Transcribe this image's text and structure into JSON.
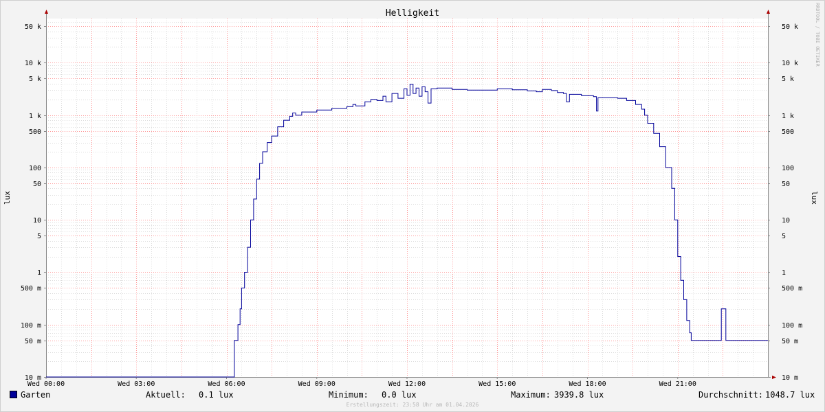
{
  "chart_data": {
    "type": "line",
    "title": "Helligkeit",
    "ylabel": "lux",
    "ylabel_right": "lux",
    "watermark": "RRDTOOL / TOBI OETIKER",
    "yscale": "log",
    "ylim": [
      0.01,
      70000
    ],
    "xlim_hours": [
      0,
      24
    ],
    "x_ticks": [
      {
        "h": 0,
        "label": "Wed 00:00"
      },
      {
        "h": 3,
        "label": "Wed 03:00"
      },
      {
        "h": 6,
        "label": "Wed 06:00"
      },
      {
        "h": 9,
        "label": "Wed 09:00"
      },
      {
        "h": 12,
        "label": "Wed 12:00"
      },
      {
        "h": 15,
        "label": "Wed 15:00"
      },
      {
        "h": 18,
        "label": "Wed 18:00"
      },
      {
        "h": 21,
        "label": "Wed 21:00"
      }
    ],
    "y_ticks": [
      {
        "v": 0.01,
        "label": "10 m"
      },
      {
        "v": 0.05,
        "label": "50 m"
      },
      {
        "v": 0.1,
        "label": "100 m"
      },
      {
        "v": 0.5,
        "label": "500 m"
      },
      {
        "v": 1,
        "label": "1"
      },
      {
        "v": 5,
        "label": "5"
      },
      {
        "v": 10,
        "label": "10"
      },
      {
        "v": 50,
        "label": "50"
      },
      {
        "v": 100,
        "label": "100"
      },
      {
        "v": 500,
        "label": "500"
      },
      {
        "v": 1000,
        "label": "1 k"
      },
      {
        "v": 5000,
        "label": "5 k"
      },
      {
        "v": 10000,
        "label": "10 k"
      },
      {
        "v": 50000,
        "label": "50 k"
      }
    ],
    "grid": true,
    "colors": {
      "series": "#000099",
      "major_grid": "#ff9999",
      "minor_grid": "#dddddd",
      "arrow": "#aa0000"
    },
    "series": [
      {
        "name": "Garten",
        "color": "#000099",
        "points": [
          [
            0,
            0.01
          ],
          [
            6.25,
            0.01
          ],
          [
            6.26,
            0.05
          ],
          [
            6.35,
            0.05
          ],
          [
            6.38,
            0.1
          ],
          [
            6.45,
            0.2
          ],
          [
            6.5,
            0.5
          ],
          [
            6.6,
            1
          ],
          [
            6.7,
            3
          ],
          [
            6.8,
            10
          ],
          [
            6.9,
            25
          ],
          [
            7.0,
            60
          ],
          [
            7.1,
            120
          ],
          [
            7.2,
            200
          ],
          [
            7.35,
            300
          ],
          [
            7.5,
            400
          ],
          [
            7.7,
            600
          ],
          [
            7.9,
            800
          ],
          [
            8.1,
            950
          ],
          [
            8.2,
            1100
          ],
          [
            8.3,
            1000
          ],
          [
            8.5,
            1150
          ],
          [
            9.0,
            1250
          ],
          [
            9.5,
            1350
          ],
          [
            10.0,
            1450
          ],
          [
            10.2,
            1600
          ],
          [
            10.3,
            1500
          ],
          [
            10.6,
            1800
          ],
          [
            10.8,
            2000
          ],
          [
            11.0,
            1900
          ],
          [
            11.2,
            2300
          ],
          [
            11.3,
            1800
          ],
          [
            11.5,
            2600
          ],
          [
            11.7,
            2100
          ],
          [
            11.9,
            3200
          ],
          [
            12.0,
            2400
          ],
          [
            12.1,
            3900
          ],
          [
            12.2,
            2600
          ],
          [
            12.3,
            3300
          ],
          [
            12.4,
            2300
          ],
          [
            12.5,
            3500
          ],
          [
            12.6,
            2800
          ],
          [
            12.7,
            1700
          ],
          [
            12.8,
            3200
          ],
          [
            13.0,
            3300
          ],
          [
            13.5,
            3100
          ],
          [
            14.0,
            3000
          ],
          [
            14.5,
            3000
          ],
          [
            15.0,
            3200
          ],
          [
            15.5,
            3050
          ],
          [
            16.0,
            2900
          ],
          [
            16.3,
            2800
          ],
          [
            16.5,
            3100
          ],
          [
            16.8,
            2950
          ],
          [
            17.0,
            2700
          ],
          [
            17.2,
            2600
          ],
          [
            17.3,
            1800
          ],
          [
            17.4,
            2500
          ],
          [
            17.8,
            2350
          ],
          [
            18.2,
            2250
          ],
          [
            18.3,
            1200
          ],
          [
            18.35,
            2150
          ],
          [
            19.0,
            2100
          ],
          [
            19.3,
            1900
          ],
          [
            19.6,
            1600
          ],
          [
            19.8,
            1300
          ],
          [
            19.9,
            1000
          ],
          [
            20.0,
            700
          ],
          [
            20.2,
            450
          ],
          [
            20.4,
            250
          ],
          [
            20.6,
            100
          ],
          [
            20.8,
            40
          ],
          [
            20.9,
            10
          ],
          [
            21.0,
            2
          ],
          [
            21.1,
            0.7
          ],
          [
            21.2,
            0.3
          ],
          [
            21.3,
            0.12
          ],
          [
            21.4,
            0.07
          ],
          [
            21.45,
            0.05
          ],
          [
            22.4,
            0.05
          ],
          [
            22.45,
            0.2
          ],
          [
            22.55,
            0.2
          ],
          [
            22.6,
            0.05
          ],
          [
            24,
            0.05
          ]
        ]
      }
    ]
  },
  "legend": {
    "name": "Garten",
    "current_label": "Aktuell:",
    "current_value": "0.1 lux",
    "min_label": "Minimum:",
    "min_value": "0.0 lux",
    "max_label": "Maximum:",
    "max_value": "3939.8 lux",
    "avg_label": "Durchschnitt:",
    "avg_value": "1048.7 lux"
  },
  "footer": {
    "created": "Erstellungszeit: 23:58 Uhr am 01.04.2026"
  }
}
